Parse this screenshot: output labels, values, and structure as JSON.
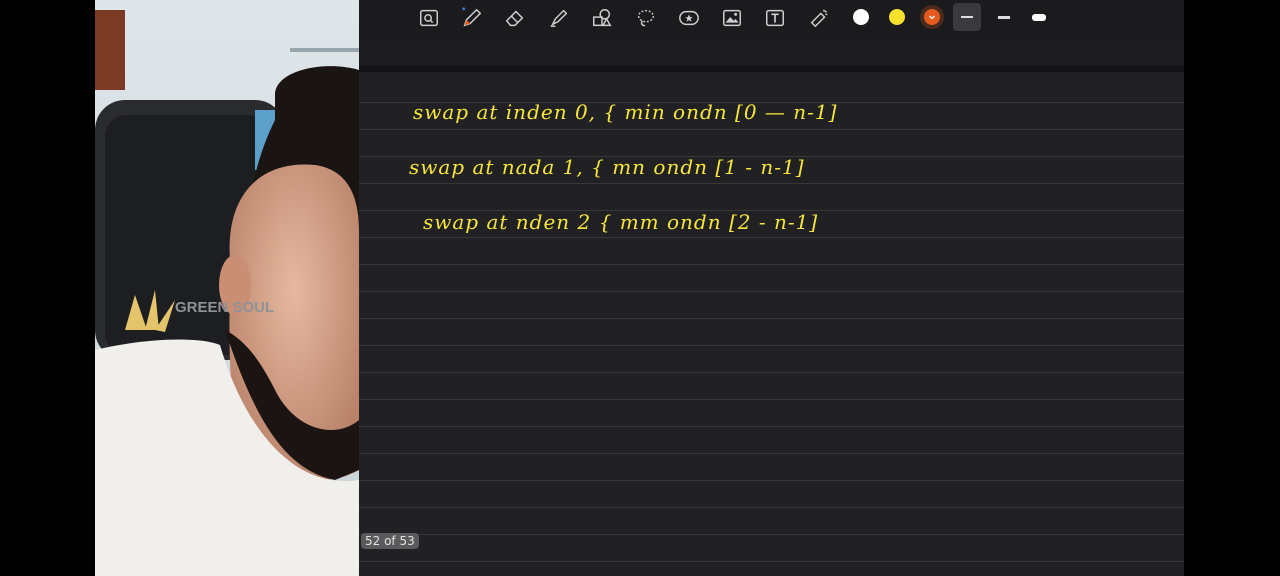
{
  "toolbar": {
    "tools": [
      {
        "name": "zoom-box-icon"
      },
      {
        "name": "pen-icon"
      },
      {
        "name": "eraser-icon"
      },
      {
        "name": "highlighter-icon"
      },
      {
        "name": "shapes-icon"
      },
      {
        "name": "lasso-icon"
      },
      {
        "name": "sticker-icon"
      },
      {
        "name": "image-icon"
      },
      {
        "name": "text-box-icon"
      },
      {
        "name": "laser-pointer-icon"
      }
    ],
    "colors": [
      "#ffffff",
      "#f7e12b",
      "#e55a1c"
    ],
    "selected_color": "#e55a1c"
  },
  "notes": {
    "ink_color": "#f5e63a",
    "lines": [
      "swap at inden 0, { min ondn [0 — n-1]",
      "swap at nada 1, { mn ondn [1 - n-1]",
      "swap at nden 2 { mm ondn [2 - n-1]"
    ]
  },
  "webcam": {
    "chair_logo": "GREEN SOUL"
  },
  "page_counter": "52 of 53"
}
